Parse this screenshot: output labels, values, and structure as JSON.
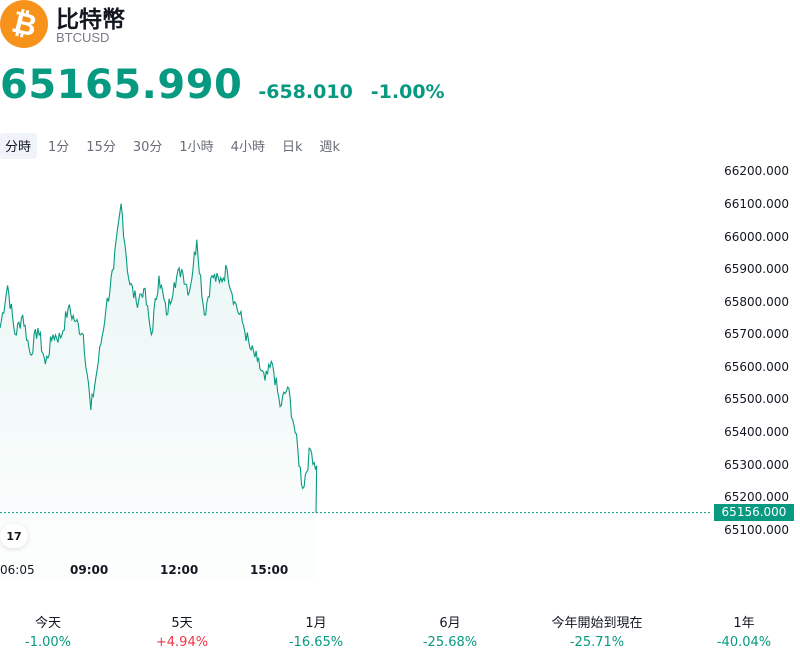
{
  "header": {
    "logo_glyph": "₿",
    "name": "比特幣",
    "symbol": "BTCUSD"
  },
  "quote": {
    "price": "65165.990",
    "change": "-658.010",
    "change_percent": "-1.00%",
    "color": "#089981"
  },
  "tabs": [
    {
      "label": "分時",
      "active": true
    },
    {
      "label": "1分",
      "active": false
    },
    {
      "label": "15分",
      "active": false
    },
    {
      "label": "30分",
      "active": false
    },
    {
      "label": "1小時",
      "active": false
    },
    {
      "label": "4小時",
      "active": false
    },
    {
      "label": "日k",
      "active": false
    },
    {
      "label": "週k",
      "active": false
    }
  ],
  "chart_data": {
    "type": "area",
    "y_ticks": [
      "66200.000",
      "66100.000",
      "66000.000",
      "65900.000",
      "65800.000",
      "65700.000",
      "65600.000",
      "65500.000",
      "65400.000",
      "65300.000",
      "65200.000",
      "65100.000"
    ],
    "ylim": [
      65100,
      66200
    ],
    "x_ticks": [
      "06:05",
      "09:00",
      "12:00",
      "15:00"
    ],
    "last_price_label": "65156.000",
    "last_price": 65156,
    "line_color": "#089981",
    "x": [
      "06:05",
      "06:20",
      "06:35",
      "06:50",
      "07:05",
      "07:20",
      "07:35",
      "07:50",
      "08:05",
      "08:20",
      "08:35",
      "08:50",
      "09:05",
      "09:20",
      "09:35",
      "09:50",
      "10:05",
      "10:20",
      "10:35",
      "10:50",
      "11:05",
      "11:20",
      "11:35",
      "11:50",
      "12:05",
      "12:20",
      "12:35",
      "12:50",
      "13:05",
      "13:20",
      "13:35",
      "13:50",
      "14:05",
      "14:20",
      "14:35",
      "14:50",
      "15:05",
      "15:20",
      "15:35",
      "15:50",
      "16:05",
      "16:20",
      "16:35",
      "16:50",
      "17:05"
    ],
    "y": [
      65720,
      65850,
      65700,
      65760,
      65640,
      65720,
      65610,
      65700,
      65690,
      65780,
      65740,
      65700,
      65470,
      65620,
      65780,
      65900,
      66100,
      65870,
      65800,
      65840,
      65700,
      65880,
      65760,
      65860,
      65900,
      65830,
      65990,
      65760,
      65880,
      65860,
      65900,
      65800,
      65740,
      65660,
      65620,
      65560,
      65610,
      65480,
      65540,
      65400,
      65230,
      65350,
      65280,
      65156,
      65156
    ]
  },
  "performance": [
    {
      "label": "今天",
      "value": "-1.00%",
      "color": "#089981"
    },
    {
      "label": "5天",
      "value": "+4.94%",
      "color": "#f23645"
    },
    {
      "label": "1月",
      "value": "-16.65%",
      "color": "#089981"
    },
    {
      "label": "6月",
      "value": "-25.68%",
      "color": "#089981"
    },
    {
      "label": "今年開始到現在",
      "value": "-25.71%",
      "color": "#089981"
    },
    {
      "label": "1年",
      "value": "-40.04%",
      "color": "#089981"
    }
  ],
  "tv_logo": "17"
}
